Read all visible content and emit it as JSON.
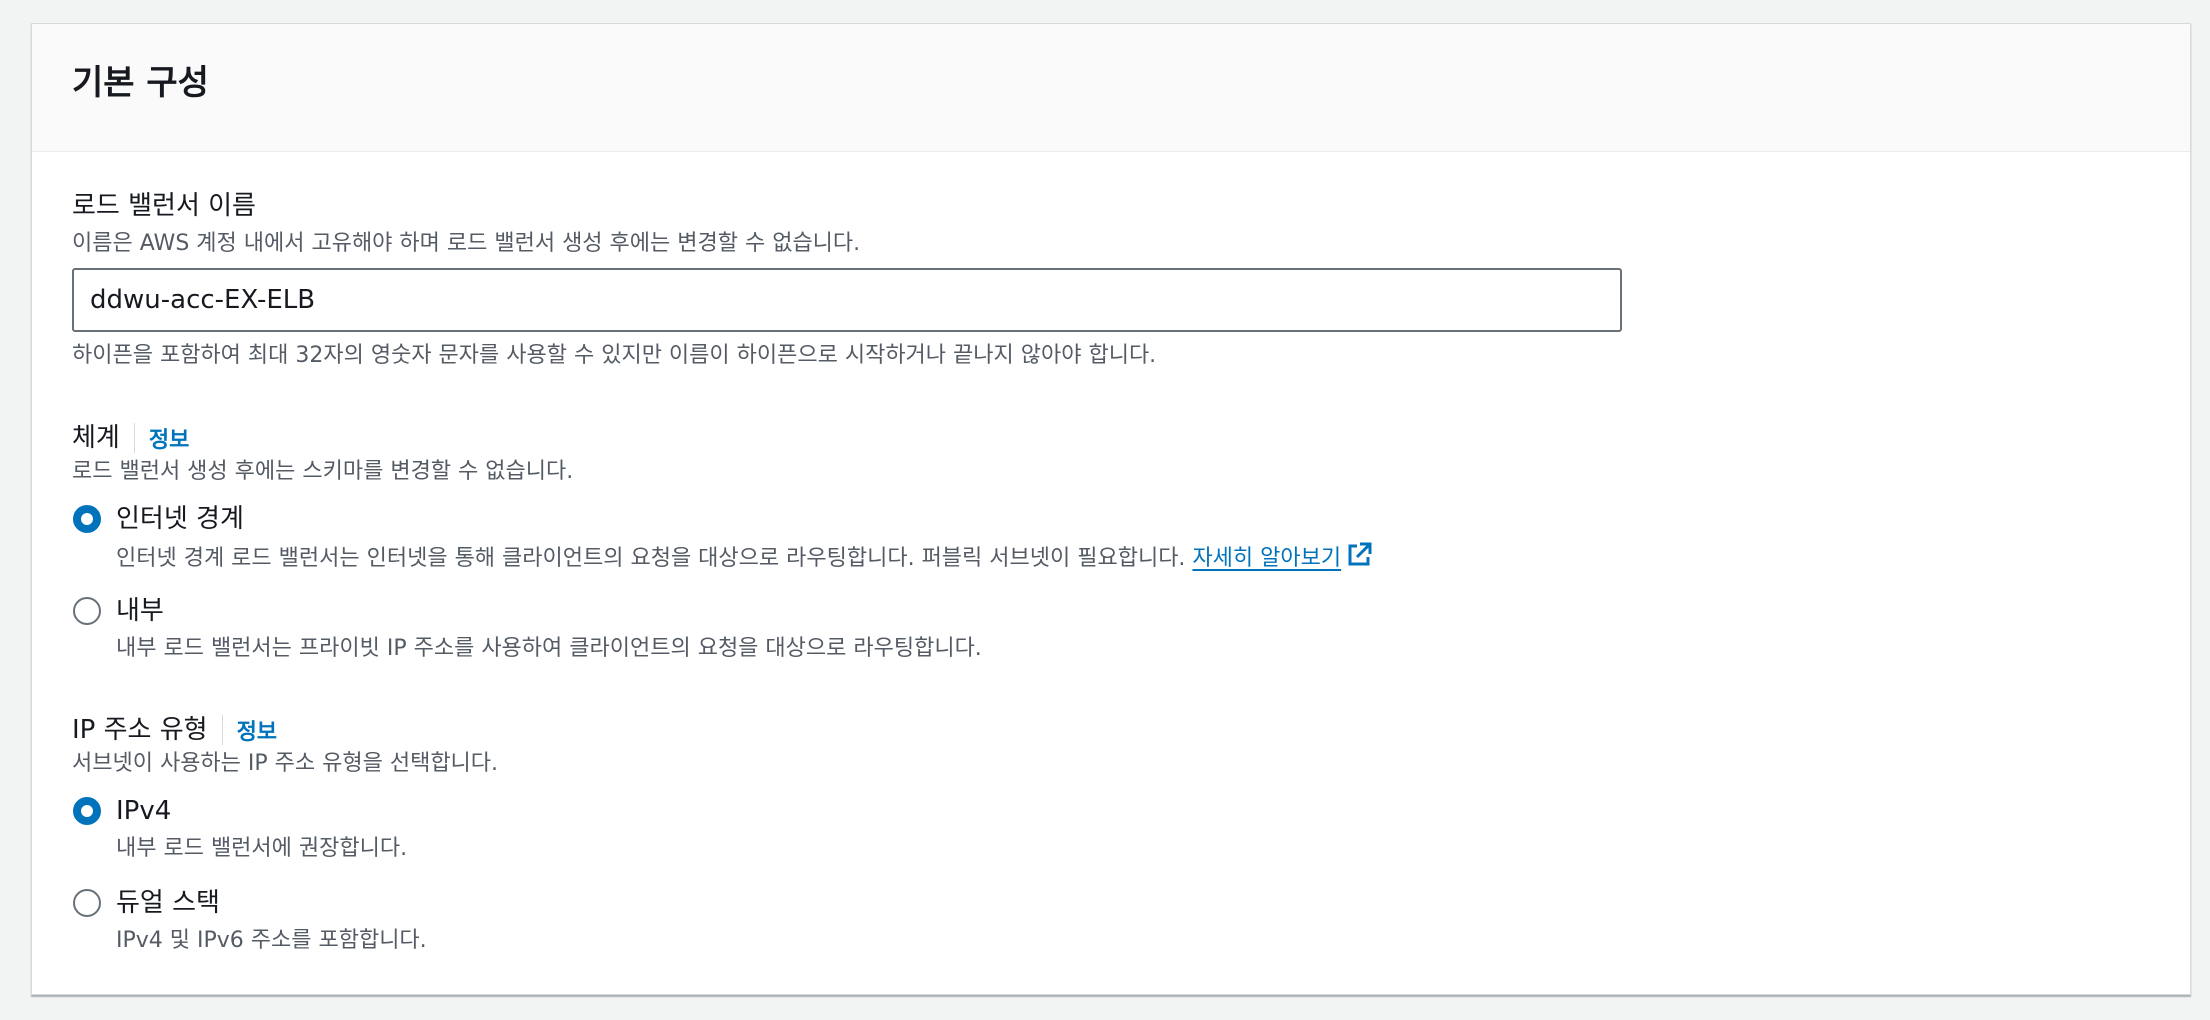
{
  "header": {
    "title": "기본 구성"
  },
  "lb_name": {
    "label": "로드 밸런서 이름",
    "description": "이름은 AWS 계정 내에서 고유해야 하며 로드 밸런서 생성 후에는 변경할 수 없습니다.",
    "value": "ddwu-acc-EX-ELB",
    "constraint": "하이픈을 포함하여 최대 32자의 영숫자 문자를 사용할 수 있지만 이름이 하이픈으로 시작하거나 끝나지 않아야 합니다."
  },
  "scheme": {
    "label": "체계",
    "info": "정보",
    "description": "로드 밸런서 생성 후에는 스키마를 변경할 수 없습니다.",
    "options": [
      {
        "label": "인터넷 경계",
        "description": "인터넷 경계 로드 밸런서는 인터넷을 통해 클라이언트의 요청을 대상으로 라우팅합니다. 퍼블릭 서브넷이 필요합니다.",
        "link": "자세히 알아보기",
        "selected": true
      },
      {
        "label": "내부",
        "description": "내부 로드 밸런서는 프라이빗 IP 주소를 사용하여 클라이언트의 요청을 대상으로 라우팅합니다.",
        "selected": false
      }
    ]
  },
  "ip_type": {
    "label": "IP 주소 유형",
    "info": "정보",
    "description": "서브넷이 사용하는 IP 주소 유형을 선택합니다.",
    "options": [
      {
        "label": "IPv4",
        "description": "내부 로드 밸런서에 권장합니다.",
        "selected": true
      },
      {
        "label": "듀얼 스택",
        "description": "IPv4 및 IPv6 주소를 포함합니다.",
        "selected": false
      }
    ]
  },
  "icons": {
    "external_link": "external-link-icon"
  },
  "colors": {
    "accent": "#0073bb",
    "text": "#16191f",
    "secondary_text": "#545b64",
    "border": "#687078",
    "page_bg": "#f2f3f3"
  }
}
